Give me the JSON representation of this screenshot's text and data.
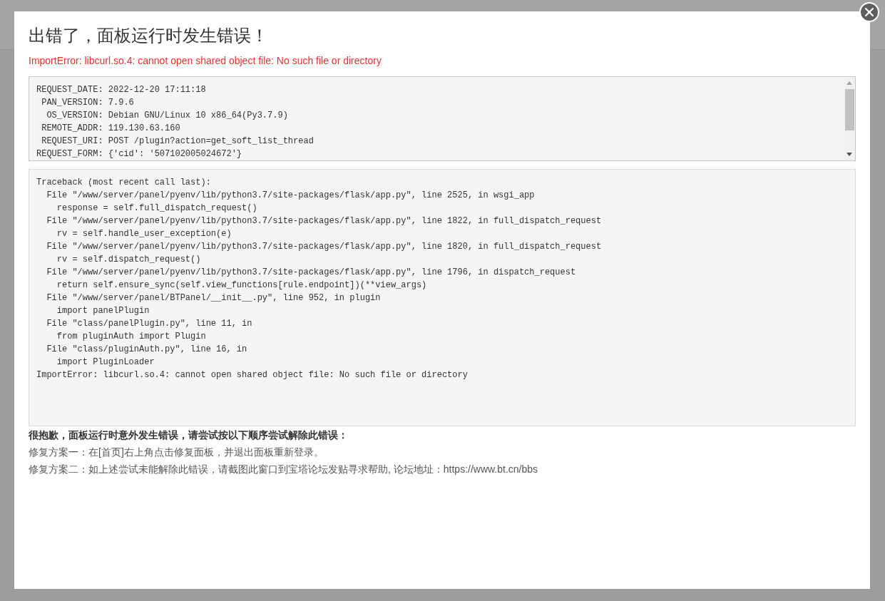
{
  "dialog": {
    "title": "出错了，面板运行时发生错误！",
    "error_message": "ImportError: libcurl.so.4: cannot open shared object file: No such file or directory"
  },
  "request_info": {
    "lines": [
      "REQUEST_DATE: 2022-12-20 17:11:18",
      " PAN_VERSION: 7.9.6",
      "  OS_VERSION: Debian GNU/Linux 10 x86_64(Py3.7.9)",
      " REMOTE_ADDR: 119.130.63.160",
      " REQUEST_URI: POST /plugin?action=get_soft_list_thread",
      "REQUEST_FORM: {'cid': '507102005024672'}"
    ]
  },
  "traceback": {
    "lines": [
      "Traceback (most recent call last):",
      "  File \"/www/server/panel/pyenv/lib/python3.7/site-packages/flask/app.py\", line 2525, in wsgi_app",
      "    response = self.full_dispatch_request()",
      "  File \"/www/server/panel/pyenv/lib/python3.7/site-packages/flask/app.py\", line 1822, in full_dispatch_request",
      "    rv = self.handle_user_exception(e)",
      "  File \"/www/server/panel/pyenv/lib/python3.7/site-packages/flask/app.py\", line 1820, in full_dispatch_request",
      "    rv = self.dispatch_request()",
      "  File \"/www/server/panel/pyenv/lib/python3.7/site-packages/flask/app.py\", line 1796, in dispatch_request",
      "    return self.ensure_sync(self.view_functions[rule.endpoint])(**view_args)",
      "  File \"/www/server/panel/BTPanel/__init__.py\", line 952, in plugin",
      "    import panelPlugin",
      "  File \"class/panelPlugin.py\", line 11, in",
      "    from pluginAuth import Plugin",
      "  File \"class/pluginAuth.py\", line 16, in",
      "    import PluginLoader",
      "ImportError: libcurl.so.4: cannot open shared object file: No such file or directory"
    ]
  },
  "help": {
    "heading": "很抱歉，面板运行时意外发生错误，请尝试按以下顺序尝试解除此错误：",
    "steps": [
      "修复方案一：在[首页]右上角点击修复面板，并退出面板重新登录。",
      "修复方案二：如上述尝试未能解除此错误，请截图此窗口到宝塔论坛发贴寻求帮助, 论坛地址：https://www.bt.cn/bbs"
    ]
  }
}
